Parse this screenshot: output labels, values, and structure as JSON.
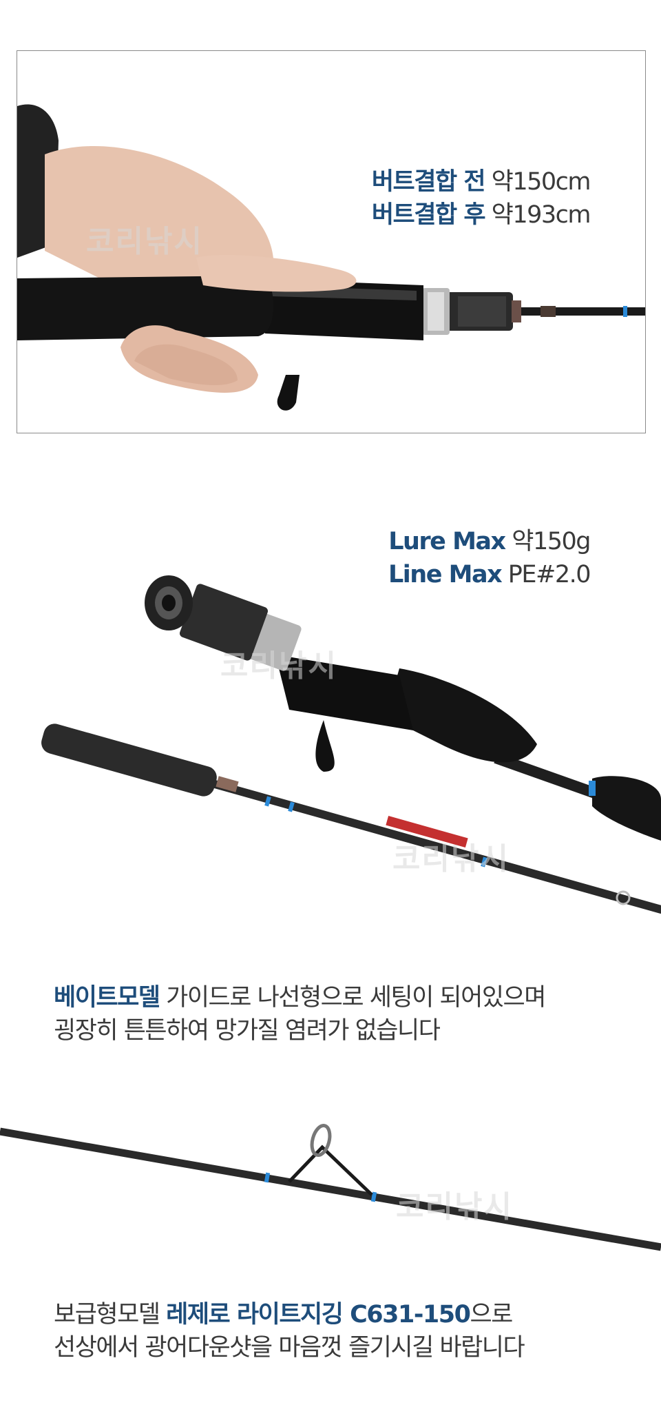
{
  "section1": {
    "line1": {
      "bold": "버트결합 전",
      "rest": " 약150cm"
    },
    "line2": {
      "bold": "버트결합 후",
      "rest": " 약193cm"
    },
    "watermark": "코리낚시"
  },
  "section2": {
    "line1": {
      "bold": "Lure Max",
      "rest": " 약150g"
    },
    "line2": {
      "bold": "Line Max",
      "rest": " PE#2.0"
    },
    "watermark_top": "코리낚시",
    "watermark_mid": "코리낚시"
  },
  "section3": {
    "line1": {
      "bold": "베이트모델",
      "rest": " 가이드로 나선형으로 세팅이 되어있으며"
    },
    "line2": "굉장히 튼튼하여 망가질 염려가 없습니다"
  },
  "section4": {
    "watermark": "코리낚시",
    "line1": {
      "pre": "보급형모델 ",
      "bold": "레제로 라이트지깅 C631-150",
      "rest": "으로"
    },
    "line2": "선상에서 광어다운샷을 마음껏 즐기시길 바랍니다"
  },
  "colors": {
    "accent": "#1e4d7b",
    "text": "#3a3a3a",
    "frame": "#8a8a8a",
    "rod": "#1a1a1a",
    "guide_blue": "#2b8ad8"
  }
}
